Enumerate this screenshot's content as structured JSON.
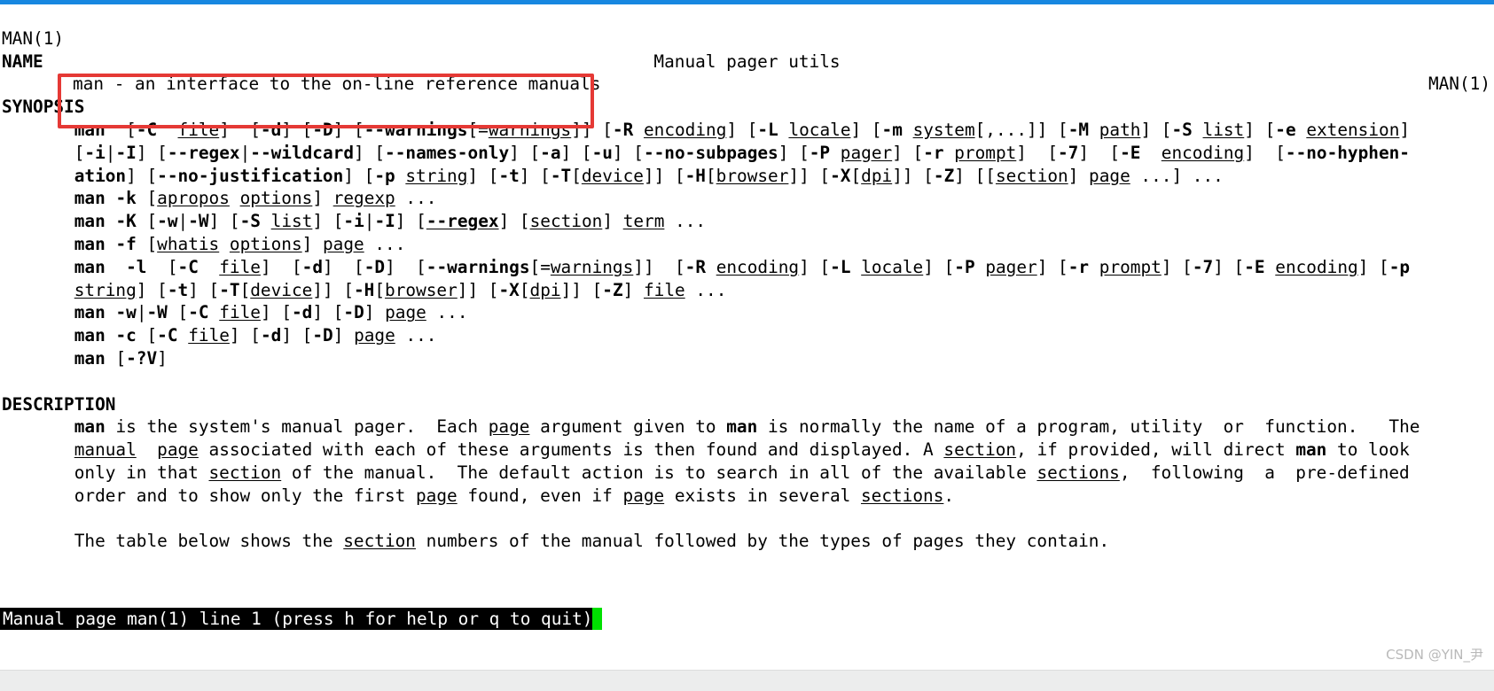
{
  "window": {
    "accent_color": "#1787e0",
    "background_color": "#ffffff",
    "text_color": "#000000"
  },
  "man": {
    "header": {
      "left": "MAN(1)",
      "center": "Manual pager utils",
      "right": "MAN(1)"
    },
    "sections": {
      "name_heading": "NAME",
      "synopsis_heading": "SYNOPSIS",
      "description_heading": "DESCRIPTION"
    },
    "name_body": "man - an interface to the on-line reference manuals",
    "synopsis_lines": [
      "man [-C file] [-d] [-D] [--warnings[=warnings]] [-R encoding] [-L locale] [-m system[,...]] [-M path] [-S list] [-e extension]",
      "[-i|-I] [--regex|--wildcard] [--names-only] [-a] [-u] [--no-subpages] [-P pager] [-r prompt] [-7] [-E encoding] [--no-hyphen-",
      "ation] [--no-justification] [-p string] [-t] [-T[device]] [-H[browser]] [-X[dpi]] [-Z] [[section] page ...] ...",
      "man -k [apropos options] regexp ...",
      "man -K [-w|-W] [-S list] [-i|-I] [--regex] [section] term ...",
      "man -f [whatis options] page ...",
      "man -l [-C file] [-d] [-D] [--warnings[=warnings]] [-R encoding] [-L locale] [-P pager] [-r prompt] [-7] [-E encoding] [-p",
      "string] [-t] [-T[device]] [-H[browser]] [-X[dpi]] [-Z] file ...",
      "man -w|-W [-C file] [-d] [-D] page ...",
      "man -c [-C file] [-d] [-D] page ...",
      "man [-?V]"
    ],
    "description_paragraph_1": [
      "man is the system's manual pager.  Each page argument given to man is normally the name of a program, utility  or  function.   The",
      "manual  page associated with each of these arguments is then found and displayed. A section, if provided, will direct man to look",
      "only in that section of the manual.  The default action is to search in all of the available sections,  following  a  pre-defined",
      "order and to show only the first page found, even if page exists in several sections."
    ],
    "description_paragraph_2": [
      "The table below shows the section numbers of the manual followed by the types of pages they contain."
    ]
  },
  "status_bar": {
    "text": "Manual page man(1) line 1 (press h for help or q to quit)",
    "background_color": "#000000",
    "text_color": "#ffffff",
    "cursor_color": "#00e000"
  },
  "annotation": {
    "highlight_color": "#e53935",
    "target": "man - an interface to the on-line reference manuals"
  },
  "watermark": {
    "text": "CSDN @YIN_尹"
  }
}
